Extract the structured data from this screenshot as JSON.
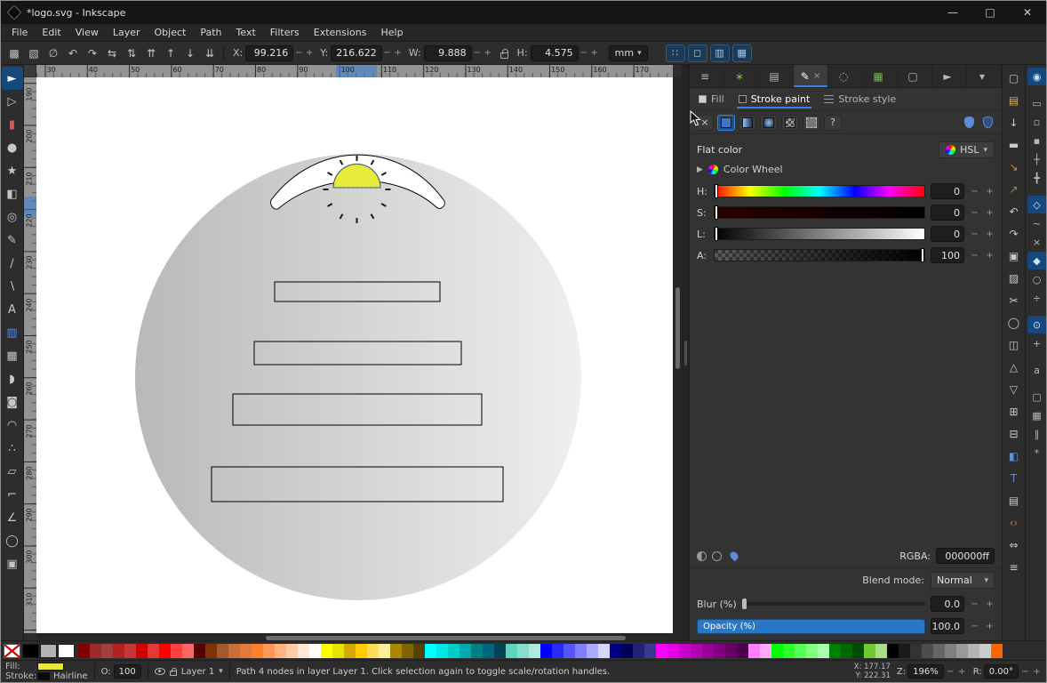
{
  "window": {
    "title": "*logo.svg - Inkscape"
  },
  "titlebar": {
    "minimize": "—",
    "maximize": "□",
    "close": "✕"
  },
  "ui": {
    "minus": "−",
    "plus": "+",
    "caret_down": "▾",
    "expander": "▶"
  },
  "menubar": {
    "items": [
      "File",
      "Edit",
      "View",
      "Layer",
      "Object",
      "Path",
      "Text",
      "Filters",
      "Extensions",
      "Help"
    ]
  },
  "toolbar": {
    "buttons": [
      {
        "name": "select-all-icon",
        "glyph": "▩"
      },
      {
        "name": "select-all-layers-icon",
        "glyph": "▧"
      },
      {
        "name": "deselect-icon",
        "glyph": "∅"
      },
      {
        "name": "rotate-ccw-icon",
        "glyph": "↶"
      },
      {
        "name": "rotate-cw-icon",
        "glyph": "↷"
      },
      {
        "name": "flip-horizontal-icon",
        "glyph": "⇆"
      },
      {
        "name": "flip-vertical-icon",
        "glyph": "⇅"
      },
      {
        "name": "raise-to-top-icon",
        "glyph": "⇈"
      },
      {
        "name": "raise-icon",
        "glyph": "↑"
      },
      {
        "name": "lower-icon",
        "glyph": "↓"
      },
      {
        "name": "lower-to-bottom-icon",
        "glyph": "⇊"
      }
    ],
    "x_label": "X:",
    "x_value": "99.216",
    "y_label": "Y:",
    "y_value": "216.622",
    "w_label": "W:",
    "w_value": "9.888",
    "h_label": "H:",
    "h_value": "4.575",
    "unit": "mm",
    "toggles": [
      {
        "name": "scale-stroke-toggle",
        "glyph": "∷"
      },
      {
        "name": "scale-corners-toggle",
        "glyph": "◻"
      },
      {
        "name": "move-gradients-toggle",
        "glyph": "▥"
      },
      {
        "name": "move-patterns-toggle",
        "glyph": "▦"
      }
    ]
  },
  "toolbox": {
    "tools": [
      {
        "name": "selector-tool",
        "glyph": "►",
        "active": true
      },
      {
        "name": "node-tool",
        "glyph": "▷"
      },
      {
        "name": "rect-tool",
        "glyph": "▮",
        "color": "#d45a5a"
      },
      {
        "name": "ellipse-tool",
        "glyph": "●"
      },
      {
        "name": "star-tool",
        "glyph": "★"
      },
      {
        "name": "box3d-tool",
        "glyph": "◧"
      },
      {
        "name": "spiral-tool",
        "glyph": "◎"
      },
      {
        "name": "pencil-tool",
        "glyph": "✎"
      },
      {
        "name": "bezier-pen-tool",
        "glyph": "∕"
      },
      {
        "name": "calligraphy-tool",
        "glyph": "∖"
      },
      {
        "name": "text-tool",
        "glyph": "A"
      },
      {
        "name": "gradient-tool",
        "glyph": "▥",
        "color": "#5b8dd9"
      },
      {
        "name": "mesh-tool",
        "glyph": "▦"
      },
      {
        "name": "dropper-tool",
        "glyph": "◗"
      },
      {
        "name": "paint-bucket-tool",
        "glyph": "◙"
      },
      {
        "name": "tweak-tool",
        "glyph": "◠"
      },
      {
        "name": "spray-tool",
        "glyph": "∴"
      },
      {
        "name": "eraser-tool",
        "glyph": "▱"
      },
      {
        "name": "connector-tool",
        "glyph": "⌐"
      },
      {
        "name": "measure-tool",
        "glyph": "∠"
      },
      {
        "name": "zoom-tool",
        "glyph": "◯"
      },
      {
        "name": "pages-tool",
        "glyph": "▣"
      }
    ]
  },
  "rulers": {
    "h_labels": [
      "30",
      "40",
      "50",
      "60",
      "70",
      "80",
      "90",
      "100",
      "110",
      "120",
      "130",
      "140",
      "150",
      "160",
      "170"
    ],
    "v_labels": [
      "190",
      "200",
      "210",
      "220",
      "230",
      "240",
      "250",
      "260",
      "270",
      "280",
      "290",
      "300",
      "310"
    ]
  },
  "canvas": {
    "page_color": "#ffffff",
    "circle_gradient": [
      "#b9b9b9",
      "#efefef"
    ],
    "shape_fill": "#ffffff",
    "sun_fill": "#eaea3c",
    "sun_stroke": "#4a4a00",
    "selection_color": "#2a6fc2"
  },
  "dialog_tabs": {
    "tabs": [
      {
        "name": "tab-align-distribute",
        "glyph": "≡"
      },
      {
        "name": "tab-symbols",
        "glyph": "∗",
        "color": "#76b34e"
      },
      {
        "name": "tab-layers",
        "glyph": "▤"
      },
      {
        "name": "tab-fill-stroke",
        "glyph": "✎",
        "active": true,
        "close": "×"
      },
      {
        "name": "tab-trace-bitmap",
        "glyph": "◌"
      },
      {
        "name": "tab-export",
        "glyph": "▦",
        "color": "#76b34e"
      },
      {
        "name": "tab-document-properties",
        "glyph": "▢"
      },
      {
        "name": "tab-objects",
        "glyph": "►"
      },
      {
        "name": "tab-more",
        "glyph": "▾"
      }
    ]
  },
  "fill_stroke": {
    "tabs": [
      {
        "label": "Fill"
      },
      {
        "label": "Stroke paint",
        "active": true
      },
      {
        "label": "Stroke style"
      }
    ],
    "paint_none_glyph": "×",
    "paint_unknown_glyph": "?",
    "heading": "Flat color",
    "mode": "HSL",
    "wheel_label": "Color Wheel",
    "channels": [
      {
        "label": "H:",
        "value": "0"
      },
      {
        "label": "S:",
        "value": "0"
      },
      {
        "label": "L:",
        "value": "0"
      },
      {
        "label": "A:",
        "value": "100"
      }
    ],
    "rgba_label": "RGBA:",
    "rgba_value": "000000ff",
    "blend_label": "Blend mode:",
    "blend_value": "Normal",
    "blur_label": "Blur (%)",
    "blur_value": "0.0",
    "opacity_label": "Opacity (%)",
    "opacity_value": "100.0"
  },
  "commands_rail": {
    "icons": [
      {
        "name": "document-new-icon",
        "glyph": "▢"
      },
      {
        "name": "document-open-icon",
        "glyph": "▤",
        "color": "#d8b36a"
      },
      {
        "name": "document-save-icon",
        "glyph": "↓"
      },
      {
        "name": "document-print-icon",
        "glyph": "▬"
      },
      {
        "name": "import-icon",
        "glyph": "↘",
        "color": "#d8883b"
      },
      {
        "name": "export-icon",
        "glyph": "↗",
        "color": "#6aa84f"
      },
      {
        "name": "undo-icon",
        "glyph": "↶"
      },
      {
        "name": "redo-icon",
        "glyph": "↷"
      },
      {
        "name": "copy-icon",
        "glyph": "▣"
      },
      {
        "name": "paste-icon",
        "glyph": "▨"
      },
      {
        "name": "cut-icon",
        "glyph": "✂"
      },
      {
        "name": "zoom-drawing-icon",
        "glyph": "◯"
      },
      {
        "name": "duplicate-icon",
        "glyph": "◫"
      },
      {
        "name": "clone-icon",
        "glyph": "△"
      },
      {
        "name": "unlink-clone-icon",
        "glyph": "▽"
      },
      {
        "name": "group-icon",
        "glyph": "⊞"
      },
      {
        "name": "ungroup-icon",
        "glyph": "⊟"
      },
      {
        "name": "fill-stroke-dialog-icon",
        "glyph": "◧",
        "color": "#5b8dd9"
      },
      {
        "name": "text-dialog-icon",
        "glyph": "T",
        "color": "#5b8dd9"
      },
      {
        "name": "layers-dialog-icon",
        "glyph": "▤"
      },
      {
        "name": "xml-editor-icon",
        "glyph": "‹›",
        "color": "#c87a3c"
      },
      {
        "name": "align-dialog-icon",
        "glyph": "⇔"
      },
      {
        "name": "preferences-icon",
        "glyph": "≡"
      }
    ]
  },
  "snap_rail": {
    "icons": [
      {
        "name": "snap-enabled-icon",
        "glyph": "◉",
        "active": true
      },
      {
        "name": "snap-bbox-icon",
        "glyph": "▭",
        "gap": true
      },
      {
        "name": "snap-bbox-edges-icon",
        "glyph": "▫"
      },
      {
        "name": "snap-bbox-corners-icon",
        "glyph": "▪"
      },
      {
        "name": "snap-edge-midpoints-icon",
        "glyph": "┼"
      },
      {
        "name": "snap-bbox-centers-icon",
        "glyph": "╋"
      },
      {
        "name": "snap-nodes-icon",
        "glyph": "◇",
        "active": true,
        "gap": true
      },
      {
        "name": "snap-path-icon",
        "glyph": "~"
      },
      {
        "name": "snap-path-intersections-icon",
        "glyph": "×"
      },
      {
        "name": "snap-cusp-nodes-icon",
        "glyph": "◆",
        "active": true
      },
      {
        "name": "snap-smooth-nodes-icon",
        "glyph": "○"
      },
      {
        "name": "snap-line-midpoints-icon",
        "glyph": "÷"
      },
      {
        "name": "snap-object-centers-icon",
        "glyph": "⊙",
        "active": true,
        "gap": true
      },
      {
        "name": "snap-rotation-centers-icon",
        "glyph": "+"
      },
      {
        "name": "snap-text-baseline-icon",
        "glyph": "a",
        "gap": true
      },
      {
        "name": "snap-page-border-icon",
        "glyph": "▢",
        "gap": true
      },
      {
        "name": "snap-grid-icon",
        "glyph": "▦"
      },
      {
        "name": "snap-guides-icon",
        "glyph": "∥"
      },
      {
        "name": "snap-guide-intersections-icon",
        "glyph": "*"
      }
    ]
  },
  "palette": {
    "left_swatches": [
      "#000000",
      "#b3b3b3",
      "#ffffff"
    ],
    "colors": [
      "#800000",
      "#982b2b",
      "#a04040",
      "#b22222",
      "#c83737",
      "#d40000",
      "#e53939",
      "#ff0000",
      "#ff4040",
      "#ff6666",
      "#550000",
      "#803300",
      "#a05a2c",
      "#c87137",
      "#e07b39",
      "#ff7f2a",
      "#ff9955",
      "#ffb380",
      "#ffccaa",
      "#ffe6d5",
      "#ffffff",
      "#ffff00",
      "#e5e500",
      "#d4aa00",
      "#ffcc00",
      "#ffdd55",
      "#ffee99",
      "#aa8800",
      "#806600",
      "#554400",
      "#00ffff",
      "#00e5e5",
      "#00cccc",
      "#00aaad",
      "#008080",
      "#006680",
      "#004455",
      "#5fd3bc",
      "#87decd",
      "#afeade",
      "#0000ff",
      "#2a2aff",
      "#5555ff",
      "#8080ff",
      "#aaaaff",
      "#d5d5ff",
      "#000080",
      "#000055",
      "#212178",
      "#3a3a8c",
      "#ff00ff",
      "#e500e5",
      "#cc00cc",
      "#b200b2",
      "#990099",
      "#800080",
      "#660066",
      "#4d004d",
      "#ff80ff",
      "#ffaaff",
      "#00ff00",
      "#2aff2a",
      "#55ff55",
      "#80ff80",
      "#aaffaa",
      "#008000",
      "#006600",
      "#004d00",
      "#71c837",
      "#aade87",
      "#000000",
      "#1a1a1a",
      "#333333",
      "#4d4d4d",
      "#666666",
      "#808080",
      "#999999",
      "#b3b3b3",
      "#cccccc",
      "#ff6600"
    ]
  },
  "statusbar": {
    "fill_label": "Fill:",
    "fill_color": "#e7e73a",
    "stroke_label": "Stroke:",
    "stroke_color": "#0a0a0a",
    "stroke_value": "Hairline",
    "opacity_label": "O:",
    "opacity_value": "100",
    "layer_label": "Layer 1",
    "message": "Path 4 nodes in layer Layer 1. Click selection again to toggle scale/rotation handles.",
    "x_label": "X:",
    "x_value": "177.17",
    "y_label": "Y:",
    "y_value": "222.31",
    "z_label": "Z:",
    "z_value": "196%",
    "r_label": "R:",
    "r_value": "0.00°"
  }
}
